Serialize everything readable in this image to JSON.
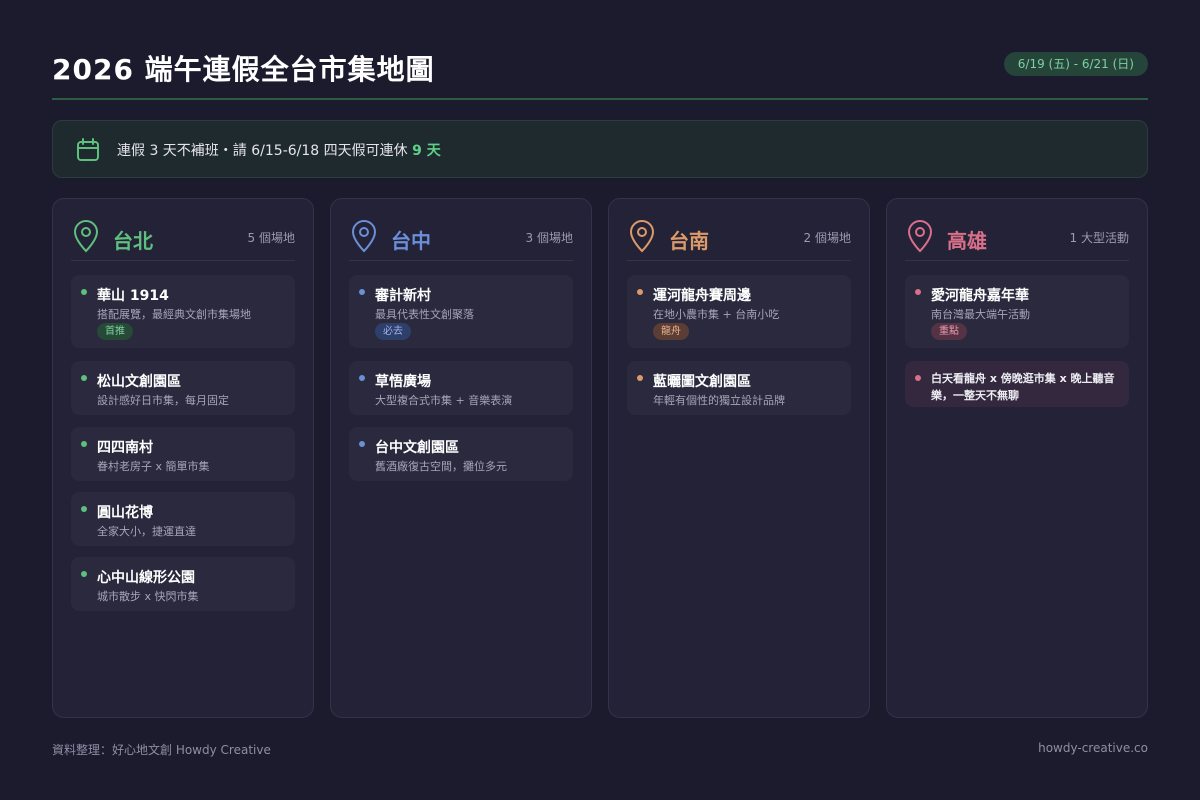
{
  "header": {
    "title": "2026 端午連假全台市集地圖",
    "date_range": "6/19 (五) - 6/21 (日)"
  },
  "notice": {
    "icon": "calendar-icon",
    "text": "連假 3 天不補班・請 6/15-6/18 四天假可連休 ",
    "highlight": "9 天"
  },
  "colors": {
    "background": "#1c1b2e",
    "taipei": "#5fbf7f",
    "taichung": "#6b8fd8",
    "tainan": "#dc9a6a",
    "kaohsiung": "#d8708a"
  },
  "regions": {
    "taipei": {
      "icon": "map-pin-icon",
      "name": "台北",
      "count": "5 個場地",
      "items": [
        {
          "title": "華山 1914",
          "desc": "搭配展覽，最經典文創市集場地",
          "tag": "首推"
        },
        {
          "title": "松山文創園區",
          "desc": "設計感好日市集，每月固定"
        },
        {
          "title": "四四南村",
          "desc": "眷村老房子 x 簡單市集"
        },
        {
          "title": "圓山花博",
          "desc": "全家大小，捷運直達"
        },
        {
          "title": "心中山線形公園",
          "desc": "城市散步 x 快閃市集"
        }
      ]
    },
    "taichung": {
      "icon": "map-pin-icon",
      "name": "台中",
      "count": "3 個場地",
      "items": [
        {
          "title": "審計新村",
          "desc": "最具代表性文創聚落",
          "tag": "必去"
        },
        {
          "title": "草悟廣場",
          "desc": "大型複合式市集 + 音樂表演"
        },
        {
          "title": "台中文創園區",
          "desc": "舊酒廠復古空間，攤位多元"
        }
      ]
    },
    "tainan": {
      "icon": "map-pin-icon",
      "name": "台南",
      "count": "2 個場地",
      "items": [
        {
          "title": "運河龍舟賽周邊",
          "desc": "在地小農市集 + 台南小吃",
          "tag": "龍舟"
        },
        {
          "title": "藍曬圖文創園區",
          "desc": "年輕有個性的獨立設計品牌"
        }
      ]
    },
    "kaohsiung": {
      "icon": "map-pin-icon",
      "name": "高雄",
      "count": "1 大型活動",
      "items": [
        {
          "title": "愛河龍舟嘉年華",
          "desc": "南台灣最大端午活動",
          "tag": "重點"
        }
      ],
      "note": "白天看龍舟 x 傍晚逛市集 x 晚上聽音樂，一整天不無聊"
    }
  },
  "footer": {
    "credit": "資料整理：好心地文創 Howdy Creative",
    "site": "howdy-creative.co"
  }
}
